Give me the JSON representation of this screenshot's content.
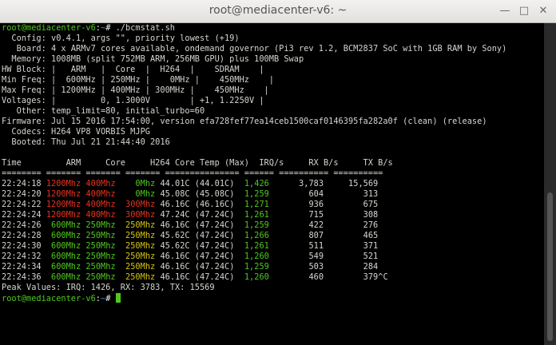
{
  "window": {
    "title": "root@mediacenter-v6: ~",
    "minimize_glyph": "—",
    "maximize_glyph": "□",
    "close_glyph": "✕"
  },
  "prompt": {
    "user_host": "root@mediacenter-v6",
    "sep": ":",
    "path": "~",
    "symbol": "#",
    "command": " ./bcmstat.sh"
  },
  "info_lines": [
    "  Config: v0.4.1, args \"\", priority lowest (+19)",
    "   Board: 4 x ARMv7 cores available, ondemand governor (Pi3 rev 1.2, BCM2837 SoC with 1GB RAM by Sony)",
    "  Memory: 1008MB (split 752MB ARM, 256MB GPU) plus 100MB Swap",
    "HW Block: |   ARM   |  Core  |  H264  |    SDRAM    |",
    "Min Freq: |  600MHz | 250MHz |    0MHz |    450MHz    |",
    "Max Freq: | 1200MHz | 400MHz | 300MHz |    450MHz    |",
    "Voltages: |         0, 1.3000V        | +1, 1.2250V |",
    "   Other: temp_limit=80, initial_turbo=60",
    "Firmware: Jul 15 2016 17:54:00, version efa728fef77ea14ceb1500caf0146395fa282a0f (clean) (release)",
    "  Codecs: H264 VP8 VORBIS MJPG",
    "  Booted: Thu Jul 21 21:44:40 2016",
    ""
  ],
  "table": {
    "header": "Time         ARM     Core     H264 Core Temp (Max)  IRQ/s     RX B/s     TX B/s",
    "rule": "======== ======= ======= ======= =============== ====== ========== ==========",
    "rows": [
      {
        "time": "22:24:18",
        "arm": "1200Mhz",
        "core": "400Mhz",
        "h264": "   0Mhz",
        "temp": "44.01C (44.01C)",
        "irq": " 1,426",
        "rx": "     3,783",
        "tx": "    15,569",
        "arm_c": "r",
        "core_c": "r",
        "h264_c": "g"
      },
      {
        "time": "22:24:20",
        "arm": "1200Mhz",
        "core": "400Mhz",
        "h264": "   0Mhz",
        "temp": "45.08C (45.08C)",
        "irq": " 1,259",
        "rx": "       604",
        "tx": "       313",
        "arm_c": "r",
        "core_c": "r",
        "h264_c": "g"
      },
      {
        "time": "22:24:22",
        "arm": "1200Mhz",
        "core": "400Mhz",
        "h264": " 300Mhz",
        "temp": "46.16C (46.16C)",
        "irq": " 1,271",
        "rx": "       936",
        "tx": "       675",
        "arm_c": "r",
        "core_c": "r",
        "h264_c": "r"
      },
      {
        "time": "22:24:24",
        "arm": "1200Mhz",
        "core": "400Mhz",
        "h264": " 300Mhz",
        "temp": "47.24C (47.24C)",
        "irq": " 1,261",
        "rx": "       715",
        "tx": "       308",
        "arm_c": "r",
        "core_c": "r",
        "h264_c": "r"
      },
      {
        "time": "22:24:26",
        "arm": " 600Mhz",
        "core": "250Mhz",
        "h264": " 250Mhz",
        "temp": "46.16C (47.24C)",
        "irq": " 1,259",
        "rx": "       422",
        "tx": "       276",
        "arm_c": "g",
        "core_c": "g",
        "h264_c": "y"
      },
      {
        "time": "22:24:28",
        "arm": " 600Mhz",
        "core": "250Mhz",
        "h264": " 250Mhz",
        "temp": "45.62C (47.24C)",
        "irq": " 1,266",
        "rx": "       807",
        "tx": "       465",
        "arm_c": "g",
        "core_c": "g",
        "h264_c": "y"
      },
      {
        "time": "22:24:30",
        "arm": " 600Mhz",
        "core": "250Mhz",
        "h264": " 250Mhz",
        "temp": "45.62C (47.24C)",
        "irq": " 1,261",
        "rx": "       511",
        "tx": "       371",
        "arm_c": "g",
        "core_c": "g",
        "h264_c": "y"
      },
      {
        "time": "22:24:32",
        "arm": " 600Mhz",
        "core": "250Mhz",
        "h264": " 250Mhz",
        "temp": "46.16C (47.24C)",
        "irq": " 1,260",
        "rx": "       549",
        "tx": "       521",
        "arm_c": "g",
        "core_c": "g",
        "h264_c": "y"
      },
      {
        "time": "22:24:34",
        "arm": " 600Mhz",
        "core": "250Mhz",
        "h264": " 250Mhz",
        "temp": "46.16C (47.24C)",
        "irq": " 1,259",
        "rx": "       503",
        "tx": "       284",
        "arm_c": "g",
        "core_c": "g",
        "h264_c": "y"
      },
      {
        "time": "22:24:36",
        "arm": " 600Mhz",
        "core": "250Mhz",
        "h264": " 250Mhz",
        "temp": "46.16C (47.24C)",
        "irq": " 1,260",
        "rx": "       460",
        "tx": "       379^C",
        "arm_c": "g",
        "core_c": "g",
        "h264_c": "y"
      }
    ],
    "peak": "Peak Values: IRQ: 1426, RX: 3783, TX: 15569"
  },
  "colors": {
    "prompt_green": "#4ec91e",
    "path_blue": "#4a8dd6",
    "high_red": "#e8321e",
    "mid_yellow": "#d6c50e",
    "bg": "#000000"
  }
}
